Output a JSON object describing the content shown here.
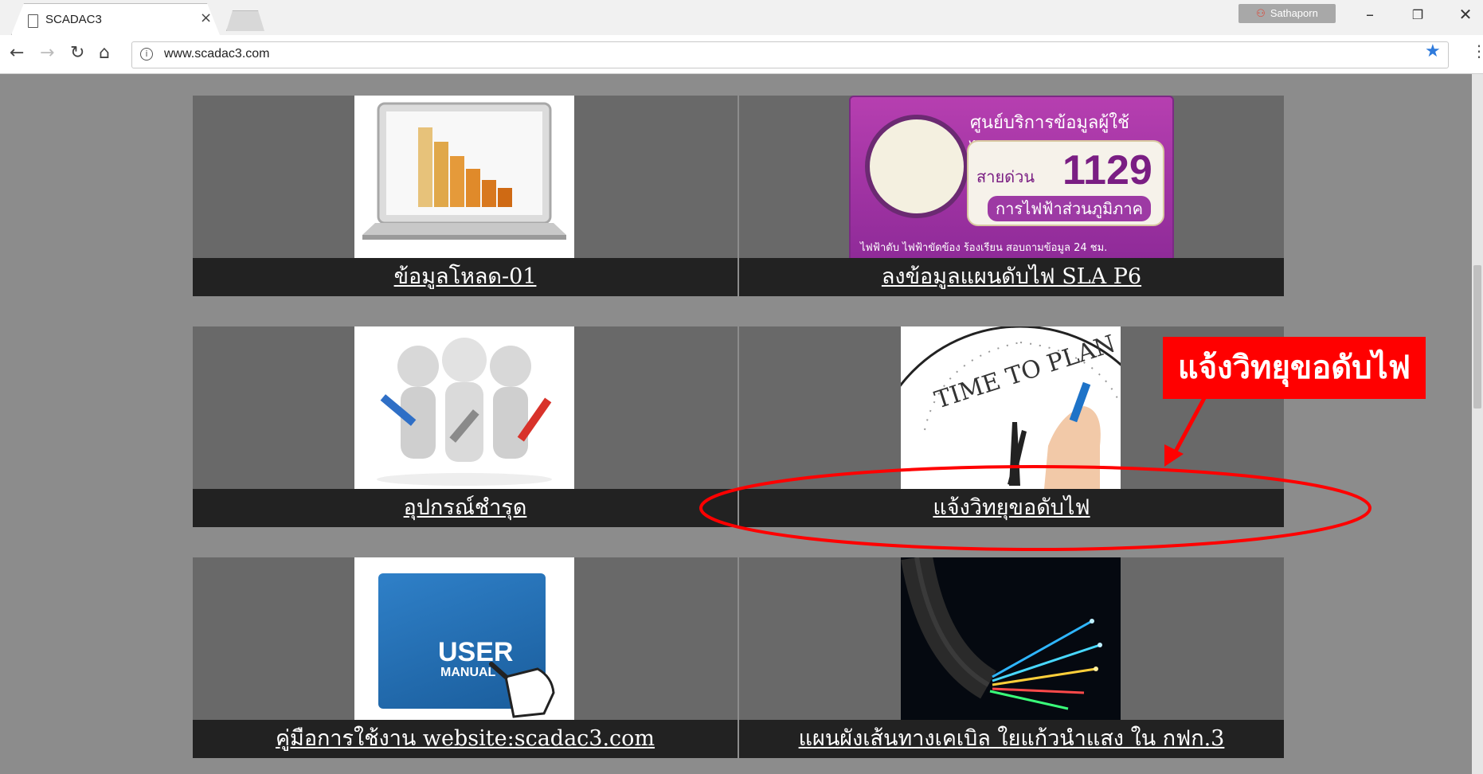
{
  "browser": {
    "tab_title": "SCADAC3",
    "tab_close": "×",
    "profile_name": "Sathaporn",
    "url": "www.scadac3.com",
    "window_controls": {
      "minimize": "–",
      "restore": "❐",
      "close": "✕"
    }
  },
  "cards": [
    {
      "label": "ข้อมูลโหลด-01",
      "icon": "laptop-bar-chart-icon"
    },
    {
      "label": "ลงข้อมูลแผนดับไฟ SLA P6",
      "icon": "pea-1129-hotline-banner"
    },
    {
      "label": "อุปกรณ์ชำรุด",
      "icon": "repair-tools-figures-icon"
    },
    {
      "label": "แจ้งวิทยุขอดับไฟ",
      "icon": "time-to-plan-clock-icon"
    },
    {
      "label": "คู่มือการใช้งาน website:scadac3.com",
      "icon": "user-manual-book-icon"
    },
    {
      "label": "แผนผังเส้นทางเคเบิล ใยแก้วนำแสง ใน กฟก.3",
      "icon": "fiber-optic-cable-icon"
    }
  ],
  "banner": {
    "title": "ศูนย์บริการข้อมูลผู้ใช้ไฟฟ้า",
    "hotline_prefix": "สายด่วน",
    "hotline_number": "1129",
    "org_name": "การไฟฟ้าส่วนภูมิภาค",
    "footer": "ไฟฟ้าดับ ไฟฟ้าขัดข้อง ร้องเรียน สอบถามข้อมูล 24 ชม."
  },
  "clock_text": "TIME TO PLAN",
  "user_manual": {
    "line1": "USER",
    "line2": "MANUAL"
  },
  "annotation": {
    "callout_text": "แจ้งวิทยุขอดับไฟ",
    "color": "#ff0000"
  }
}
